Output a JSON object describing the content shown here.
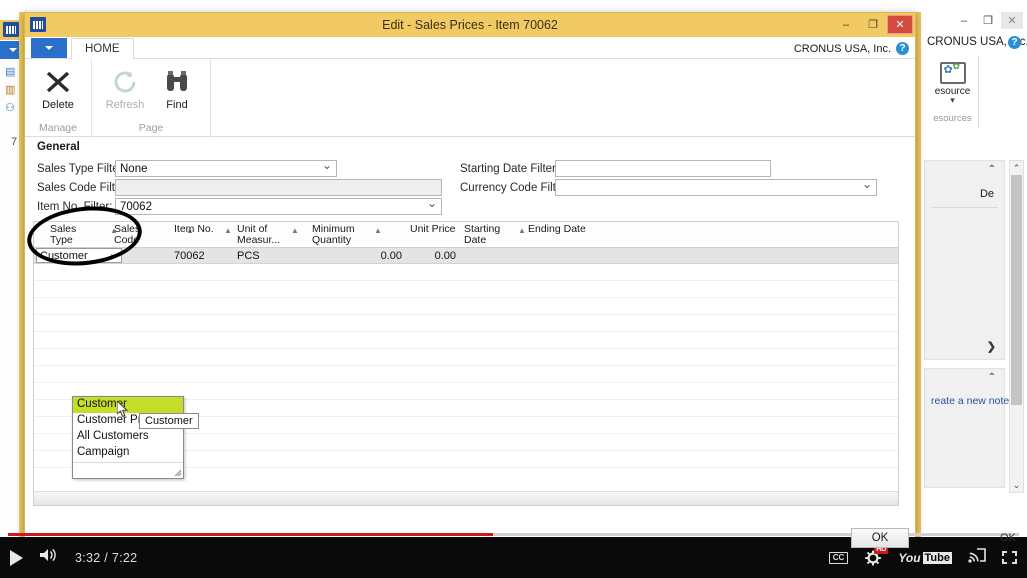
{
  "window": {
    "title": "Edit - Sales Prices - Item 70062",
    "minimize": "–",
    "maximize": "❐",
    "close": "✕",
    "app_icon": "nav-logo-icon"
  },
  "ribbon": {
    "app_button": "app-menu-icon",
    "tabs": [
      {
        "label": "HOME"
      }
    ],
    "company": "CRONUS USA, Inc.",
    "help": "?",
    "groups": [
      {
        "name": "Manage",
        "items": [
          {
            "label": "Delete",
            "icon": "delete-x-icon",
            "enabled": true
          }
        ]
      },
      {
        "name": "Page",
        "items": [
          {
            "label": "Refresh",
            "icon": "refresh-icon",
            "enabled": false
          },
          {
            "label": "Find",
            "icon": "binoculars-icon",
            "enabled": true
          }
        ]
      }
    ]
  },
  "general": {
    "heading": "General",
    "fields": [
      {
        "label": "Sales Type Filter:",
        "value": "None",
        "type": "combo"
      },
      {
        "label": "Sales Code Filter:",
        "value": "",
        "type": "readonly"
      },
      {
        "label": "Item No. Filter:",
        "value": "70062",
        "type": "combo"
      },
      {
        "label": "Starting Date Filter:",
        "value": "",
        "type": "text"
      },
      {
        "label": "Currency Code Filter:",
        "value": "",
        "type": "combo"
      }
    ]
  },
  "grid": {
    "columns": [
      {
        "label": "Sales\nType",
        "l1": "Sales",
        "l2": "Type",
        "sort": "▲"
      },
      {
        "label": "Sales Code",
        "l1": "Sales",
        "l2": "Code",
        "sort": "▲"
      },
      {
        "label": "Item No.",
        "l1": "Item No.",
        "l2": "",
        "sort": "▲"
      },
      {
        "label": "Unit of Measur...",
        "l1": "Unit of",
        "l2": "Measur...",
        "sort": "▲"
      },
      {
        "label": "Minimum Quantity",
        "l1": "Minimum",
        "l2": "Quantity",
        "sort": "▲"
      },
      {
        "label": "Unit Price",
        "l1": "Unit Price",
        "l2": "",
        "sort": ""
      },
      {
        "label": "Starting Date",
        "l1": "Starting",
        "l2": "Date",
        "sort": "▲"
      },
      {
        "label": "Ending Date",
        "l1": "Ending Date",
        "l2": "",
        "sort": ""
      }
    ],
    "rows": [
      {
        "sales_type": "Customer",
        "sales_code": "",
        "item_no": "70062",
        "unit_of_measure": "PCS",
        "minimum_quantity": "0.00",
        "unit_price": "0.00",
        "starting_date": "",
        "ending_date": ""
      }
    ]
  },
  "dropdown": {
    "options": [
      {
        "label": "Customer",
        "selected": true
      },
      {
        "label": "Customer Price Group",
        "selected": false
      },
      {
        "label": "All Customers",
        "selected": false
      },
      {
        "label": "Campaign",
        "selected": false
      }
    ],
    "tooltip": "Customer"
  },
  "buttons": {
    "ok": "OK",
    "ok_background": "OK"
  },
  "background": {
    "company": "CRONUS USA, Inc.",
    "help": "?",
    "minimize": "–",
    "maximize": "❐",
    "close": "✕",
    "ribbon_item": {
      "label": "esource",
      "group": "esources",
      "icon": "resource-gear-icon"
    },
    "factbox_text": "De",
    "factbox_note": "reate a new note.",
    "collapse_caret": "⌃",
    "expand_arrow": "❯",
    "item_number": "7"
  },
  "player": {
    "play_label": "play-icon",
    "volume_label": "volume-icon",
    "time": "3:32 / 7:22",
    "current_time": "3:32",
    "duration": "7:22",
    "progress_percent": 48,
    "cc": "CC",
    "quality_badge": "HD",
    "logo_you": "You",
    "logo_tube": "Tube",
    "cast_label": "cast-icon",
    "fullscreen_label": "fullscreen-icon",
    "accent": "#cc181e"
  }
}
